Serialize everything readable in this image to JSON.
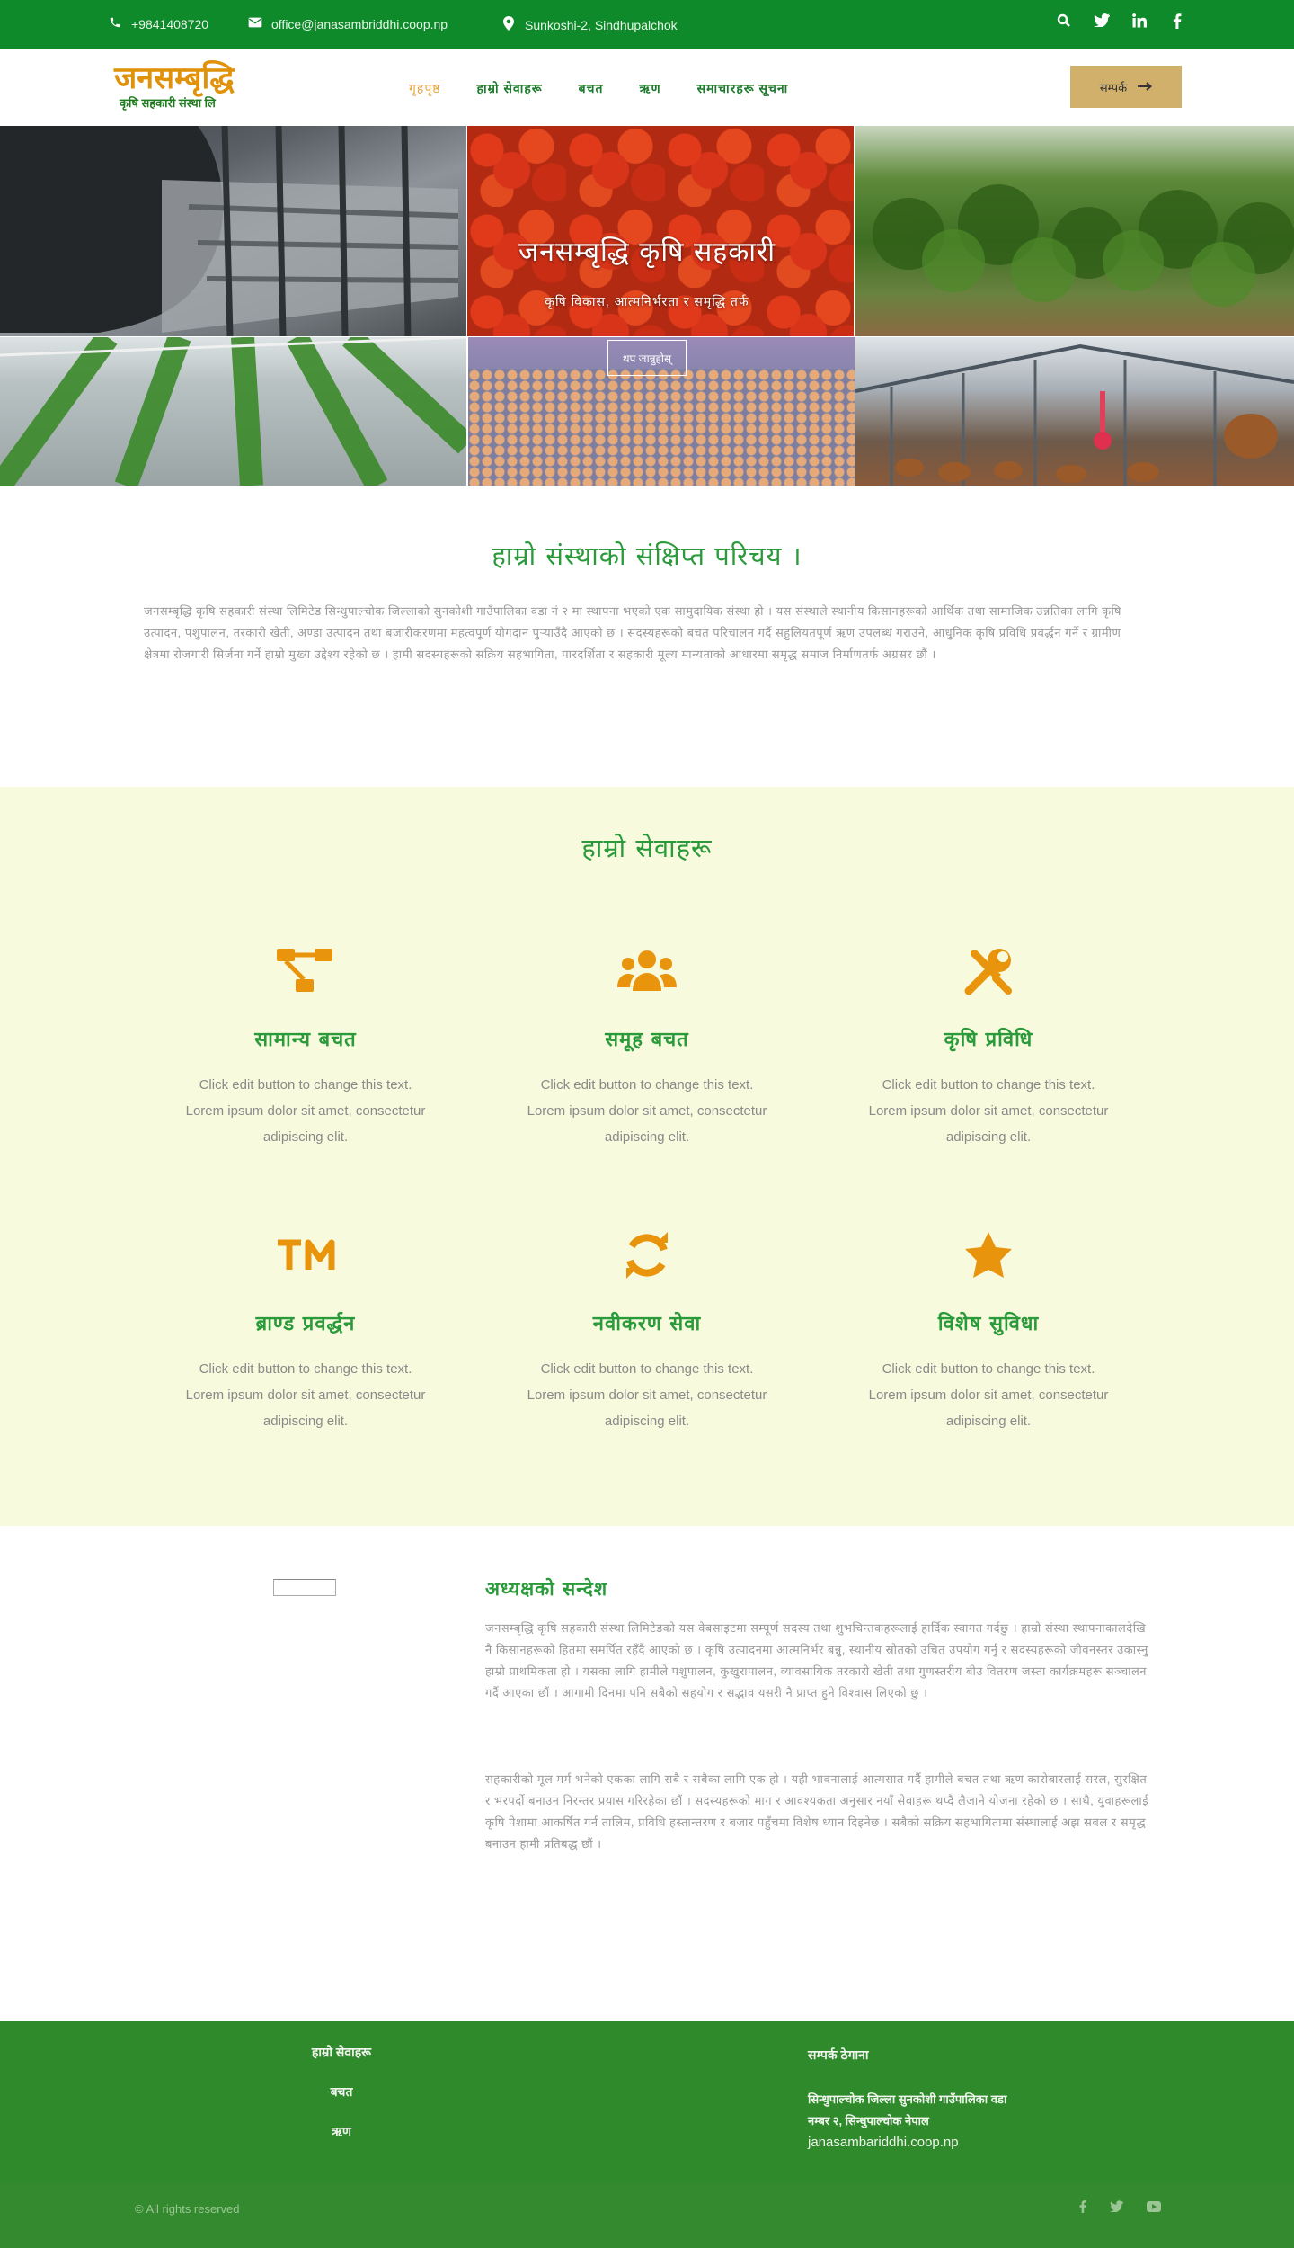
{
  "topbar": {
    "phone": "+9841408720",
    "email": "office@janasambriddhi.coop.np",
    "address": "Sunkoshi-2, Sindhupalchok",
    "icons": [
      "phone-icon",
      "envelope-icon",
      "map-pin-icon",
      "search-icon",
      "twitter-icon",
      "linkedin-icon",
      "facebook-icon"
    ],
    "social": {
      "search": "⌕",
      "twitter": "t",
      "linkedin": "in",
      "facebook": "f"
    }
  },
  "header": {
    "logo_main": "जनसम्बृद्धि",
    "logo_sub": "कृषि सहकारी संस्था लि",
    "nav": [
      "गृहपृष्ठ",
      "हाम्रो सेवाहरू",
      "बचत",
      "ऋण",
      "समाचारहरू सूचना"
    ],
    "cta_label": "सम्पर्क",
    "cta_arrow": "➞"
  },
  "hero": {
    "title": "जनसम्बृद्धि कृषि सहकारी",
    "subtitle": "कृषि विकास, आत्मनिर्भरता र समृद्धि तर्फ",
    "button": "थप जान्नुहोस्"
  },
  "about": {
    "title": "हाम्रो संस्थाको संक्षिप्त परिचय ।",
    "text": "जनसम्बृद्धि कृषि सहकारी संस्था लिमिटेड सिन्धुपाल्चोक जिल्लाको सुनकोशी गाउँपालिका वडा नं २ मा स्थापना भएको एक सामुदायिक संस्था हो । यस संस्थाले स्थानीय किसानहरूको आर्थिक तथा सामाजिक उन्नतिका लागि कृषि उत्पादन, पशुपालन, तरकारी खेती, अण्डा उत्पादन तथा बजारीकरणमा महत्वपूर्ण योगदान पुर्‍याउँदै आएको छ । सदस्यहरूको बचत परिचालन गर्दै सहुलियतपूर्ण ऋण उपलब्ध गराउने, आधुनिक कृषि प्रविधि प्रवर्द्धन गर्ने र ग्रामीण क्षेत्रमा रोजगारी सिर्जना गर्ने हाम्रो मुख्य उद्देश्य रहेको छ । हामी सदस्यहरूको सक्रिय सहभागिता, पारदर्शिता र सहकारी मूल्य मान्यताको आधारमा समृद्ध समाज निर्माणतर्फ अग्रसर छौं ।"
  },
  "services": {
    "title": "हाम्रो सेवाहरू",
    "items": [
      {
        "icon": "sitemap-icon",
        "title": "सामान्य बचत",
        "text": "Click edit button to change this text. Lorem ipsum dolor sit amet, consectetur adipiscing elit."
      },
      {
        "icon": "users-icon",
        "title": "समूह बचत",
        "text": "Click edit button to change this text. Lorem ipsum dolor sit amet, consectetur adipiscing elit."
      },
      {
        "icon": "tools-icon",
        "title": "कृषि प्रविधि",
        "text": "Click edit button to change this text. Lorem ipsum dolor sit amet, consectetur adipiscing elit."
      },
      {
        "icon": "trademark-icon",
        "title": "ब्राण्ड प्रवर्द्धन",
        "text": "Click edit button to change this text. Lorem ipsum dolor sit amet, consectetur adipiscing elit."
      },
      {
        "icon": "sync-icon",
        "title": "नवीकरण सेवा",
        "text": "Click edit button to change this text. Lorem ipsum dolor sit amet, consectetur adipiscing elit."
      },
      {
        "icon": "star-icon",
        "title": "विशेष सुविधा",
        "text": "Click edit button to change this text. Lorem ipsum dolor sit amet, consectetur adipiscing elit."
      }
    ]
  },
  "intro": {
    "title": "अध्यक्षको सन्देश",
    "para1": "जनसम्बृद्धि कृषि सहकारी संस्था लिमिटेडको यस वेबसाइटमा सम्पूर्ण सदस्य तथा शुभचिन्तकहरूलाई हार्दिक स्वागत गर्दछु । हाम्रो संस्था स्थापनाकालदेखि नै किसानहरूको हितमा समर्पित रहँदै आएको छ । कृषि उत्पादनमा आत्मनिर्भर बन्नु, स्थानीय स्रोतको उचित उपयोग गर्नु र सदस्यहरूको जीवनस्तर उकास्नु हाम्रो प्राथमिकता हो । यसका लागि हामीले पशुपालन, कुखुरापालन, व्यावसायिक तरकारी खेती तथा गुणस्तरीय बीउ वितरण जस्ता कार्यक्रमहरू सञ्चालन गर्दै आएका छौं । आगामी दिनमा पनि सबैको सहयोग र सद्भाव यसरी नै प्राप्त हुने विश्वास लिएको छु ।",
    "para2": "सहकारीको मूल मर्म भनेको एकका लागि सबै र सबैका लागि एक हो । यही भावनालाई आत्मसात गर्दै हामीले बचत तथा ऋण कारोबारलाई सरल, सुरक्षित र भरपर्दो बनाउन निरन्तर प्रयास गरिरहेका छौं । सदस्यहरूको माग र आवश्यकता अनुसार नयाँ सेवाहरू थप्दै लैजाने योजना रहेको छ । साथै, युवाहरूलाई कृषि पेशामा आकर्षित गर्न तालिम, प्रविधि हस्तान्तरण र बजार पहुँचमा विशेष ध्यान दिइनेछ । सबैको सक्रिय सहभागितामा संस्थालाई अझ सबल र समृद्ध बनाउन हामी प्रतिबद्ध छौं ।"
  },
  "footer": {
    "links": [
      "हाम्रो सेवाहरू",
      "बचत",
      "ऋण"
    ],
    "contact_title": "सम्पर्क ठेगाना",
    "contact_line1": "सिन्धुपाल्चोक जिल्ला सुनकोशी गाउँपालिका वडा",
    "contact_line2": "नम्बर २, सिन्धुपाल्चोक नेपाल",
    "contact_web": "janasambariddhi.coop.np",
    "copyright": "© All rights reserved",
    "social": {
      "facebook": "f",
      "twitter": "t",
      "youtube": "▶"
    }
  },
  "colors": {
    "primary_green": "#0f8a2a",
    "accent_orange": "#e8940c",
    "cta_gold": "#d1b06b",
    "services_bg": "#f8fadd",
    "footer_green": "#2e8a2a"
  }
}
